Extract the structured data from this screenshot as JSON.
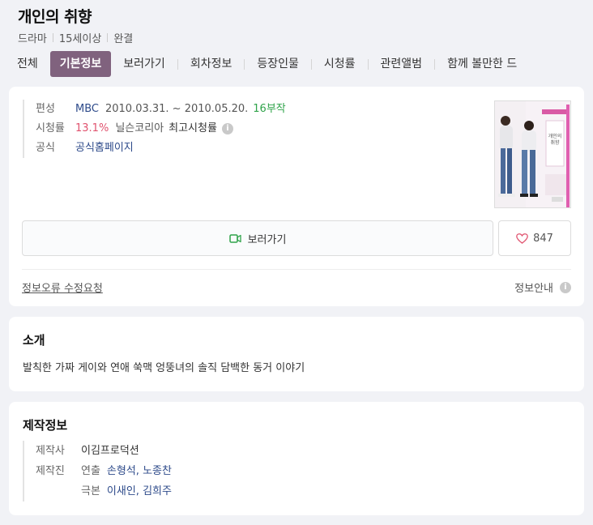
{
  "header": {
    "title": "개인의 취향",
    "meta": [
      "드라마",
      "15세이상",
      "완결"
    ]
  },
  "tabs": [
    {
      "label": "전체",
      "active": false
    },
    {
      "label": "기본정보",
      "active": true
    },
    {
      "label": "보러가기",
      "active": false
    },
    {
      "label": "회차정보",
      "active": false
    },
    {
      "label": "등장인물",
      "active": false
    },
    {
      "label": "시청률",
      "active": false
    },
    {
      "label": "관련앨범",
      "active": false
    },
    {
      "label": "함께 볼만한 드",
      "active": false
    }
  ],
  "info": {
    "broadcast_label": "편성",
    "channel": "MBC",
    "period": "2010.03.31. ~ 2010.05.20.",
    "episodes": "16부작",
    "rating_label": "시청률",
    "rating_value": "13.1%",
    "rating_source": "닐슨코리아",
    "rating_kind": "최고시청률",
    "official_label": "공식",
    "official_link": "공식홈페이지"
  },
  "poster": {
    "alt": "개인의 취향 포스터"
  },
  "actions": {
    "watch_label": "보러가기",
    "like_count": "847"
  },
  "footer": {
    "report": "정보오류 수정요청",
    "guide": "정보안내"
  },
  "intro": {
    "title": "소개",
    "text": "발칙한 가짜 게이와 연애 쑥맥 엉뚱녀의 솔직 담백한 동거 이야기"
  },
  "production": {
    "title": "제작정보",
    "company_label": "제작사",
    "company": "이김프로덕션",
    "staff_label": "제작진",
    "director_label": "연출",
    "directors": "손형석, 노종찬",
    "writer_label": "극본",
    "writers": "이새인, 김희주"
  },
  "colors": {
    "accent": "#80627e",
    "link": "#2d4a8a",
    "rating": "#e0526e",
    "episodes": "#2fa34a",
    "background": "#f1f2f6"
  }
}
